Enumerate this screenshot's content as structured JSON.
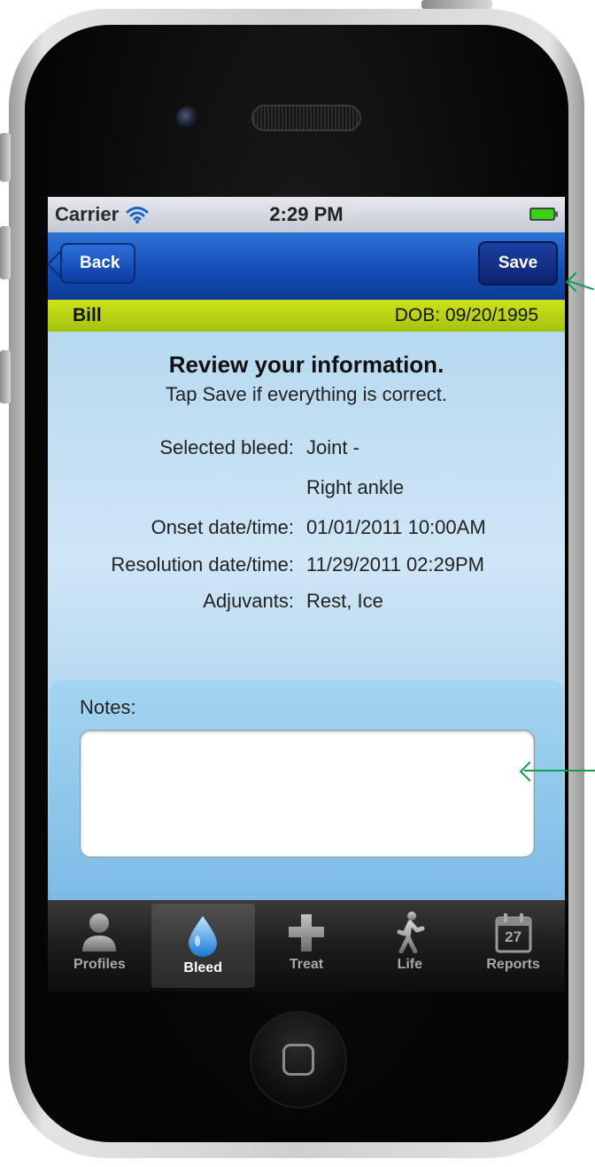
{
  "status": {
    "carrier": "Carrier",
    "time": "2:29 PM"
  },
  "nav": {
    "back_label": "Back",
    "save_label": "Save"
  },
  "profile": {
    "name": "Bill",
    "dob": "DOB: 09/20/1995"
  },
  "review": {
    "title": "Review your information.",
    "subtitle": "Tap Save if everything is correct.",
    "rows": [
      {
        "label": "Selected bleed:",
        "value": "Joint -"
      },
      {
        "label": "",
        "value": "Right ankle"
      },
      {
        "label": "Onset date/time:",
        "value": "01/01/2011 10:00AM"
      },
      {
        "label": "Resolution date/time:",
        "value": "11/29/2011 02:29PM"
      },
      {
        "label": "Adjuvants:",
        "value": "Rest, Ice"
      }
    ]
  },
  "notes": {
    "label": "Notes:",
    "value": ""
  },
  "tabs": [
    {
      "label": "Profiles",
      "icon": "person-icon"
    },
    {
      "label": "Bleed",
      "icon": "drop-icon"
    },
    {
      "label": "Treat",
      "icon": "plus-icon"
    },
    {
      "label": "Life",
      "icon": "walker-icon"
    },
    {
      "label": "Reports",
      "icon": "calendar-icon",
      "badge": "27"
    }
  ],
  "colors": {
    "navbar": "#1550b8",
    "profilebar": "#b9d514",
    "callout": "#129c52"
  }
}
